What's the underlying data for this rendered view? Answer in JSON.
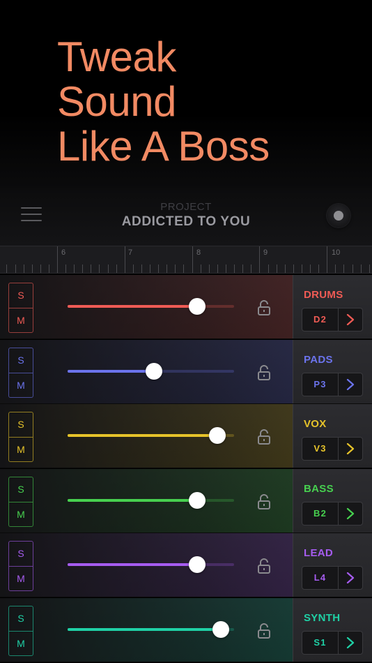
{
  "hero": {
    "lines": [
      "Tweak",
      "Sound",
      "Like A Boss"
    ]
  },
  "header": {
    "project_label": "PROJECT",
    "project_name": "ADDICTED TO YOU",
    "menu_icon": "hamburger-menu-icon",
    "record_icon": "record-icon"
  },
  "ruler": {
    "labels": [
      "6",
      "7",
      "8",
      "9",
      "10"
    ]
  },
  "tracks": [
    {
      "name": "DRUMS",
      "preset": "D2",
      "solo": "S",
      "mute": "M",
      "color": "#ef5b55",
      "level": 0.78
    },
    {
      "name": "PADS",
      "preset": "P3",
      "solo": "S",
      "mute": "M",
      "color": "#6b73ec",
      "level": 0.52
    },
    {
      "name": "VOX",
      "preset": "V3",
      "solo": "S",
      "mute": "M",
      "color": "#e6c32a",
      "level": 0.9
    },
    {
      "name": "BASS",
      "preset": "B2",
      "solo": "S",
      "mute": "M",
      "color": "#47d04f",
      "level": 0.78
    },
    {
      "name": "LEAD",
      "preset": "L4",
      "solo": "S",
      "mute": "M",
      "color": "#a65cf0",
      "level": 0.78
    },
    {
      "name": "SYNTH",
      "preset": "S1",
      "solo": "S",
      "mute": "M",
      "color": "#1fd1a6",
      "level": 0.92
    }
  ]
}
